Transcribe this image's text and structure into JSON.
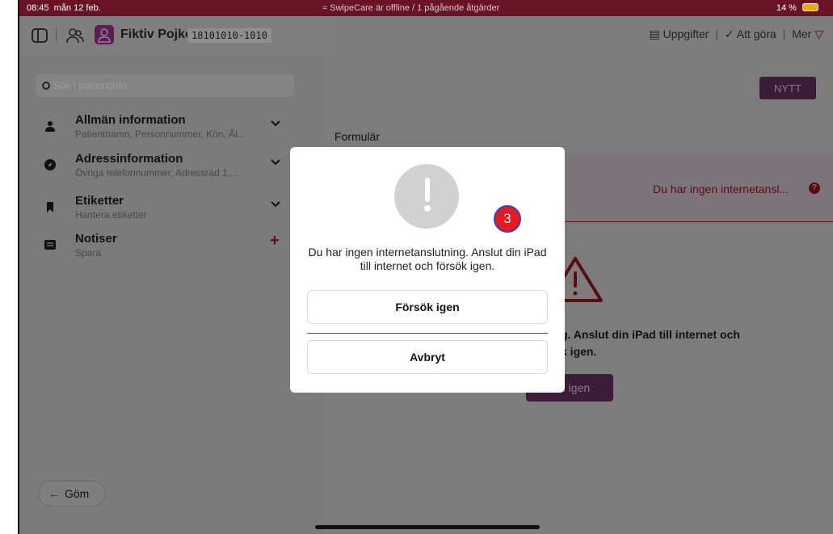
{
  "status_bar": {
    "time": "08:45",
    "date": "mån 12 feb.",
    "connection_message": "SwipeCare är offline / 1 pågående åtgärder",
    "battery": "14 %"
  },
  "header": {
    "patient_name": "Fiktiv Pojke",
    "patient_id": "18101010-1010",
    "tasks_label": "Uppgifter",
    "todo_label": "Att göra",
    "more_label": "Mer"
  },
  "sidebar": {
    "search_placeholder": "Sök i patientinfo",
    "items": [
      {
        "title": "Allmän information",
        "subtitle": "Patientnamn, Personnummer, Kön, Ål...",
        "action": "expand"
      },
      {
        "title": "Adressinformation",
        "subtitle": "Övriga telefonnummer, Adressrad 1,...",
        "action": "expand"
      },
      {
        "title": "Etiketter",
        "subtitle": "Hantera etiketter",
        "action": "expand"
      },
      {
        "title": "Notiser",
        "subtitle": "Spara",
        "action": "add"
      }
    ],
    "hide_label": "Göm"
  },
  "main": {
    "new_button": "NYTT",
    "section_title": "Formulär",
    "error_text": "Du har ingen internetansl...",
    "background_message_line1": "g. Anslut din iPad till internet och",
    "background_message_line2": "k igen.",
    "background_button": "ök igen"
  },
  "dialog": {
    "badge_number": "3",
    "message": "Du har ingen internetanslutning. Anslut din iPad till internet och försök igen.",
    "retry_button": "Försök igen",
    "cancel_button": "Avbryt"
  },
  "colors": {
    "status_bar": "#6a1326",
    "accent_purple": "#5a1e52",
    "badge_red": "#e8191d",
    "badge_ring": "#3a3ad8"
  }
}
